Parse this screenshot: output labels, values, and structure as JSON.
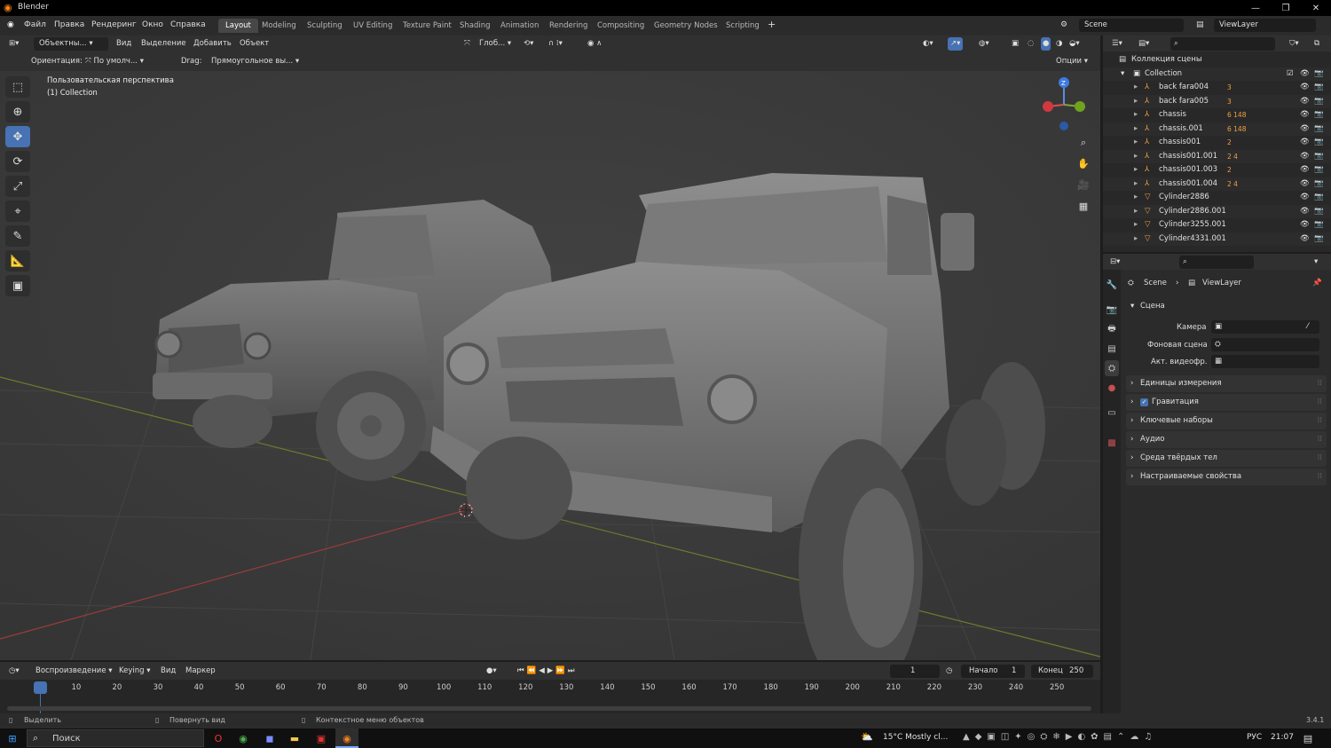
{
  "window": {
    "title": "Blender"
  },
  "menu": [
    "Файл",
    "Правка",
    "Рендеринг",
    "Окно",
    "Справка"
  ],
  "workspaces": [
    "Layout",
    "Modeling",
    "Sculpting",
    "UV Editing",
    "Texture Paint",
    "Shading",
    "Animation",
    "Rendering",
    "Compositing",
    "Geometry Nodes",
    "Scripting"
  ],
  "workspace_active": "Layout",
  "scene_name": "Scene",
  "view_layer_name": "ViewLayer",
  "viewport": {
    "mode": "Объектны...",
    "menus": [
      "Вид",
      "Выделение",
      "Добавить",
      "Объект"
    ],
    "transform": "Глоб...",
    "orientation_label": "Ориентация:",
    "orientation_value": "По умолч...",
    "drag_label": "Drag:",
    "drag_value": "Прямоугольное вы...",
    "options": "Опции",
    "overlay_line1": "Пользовательская перспектива",
    "overlay_line2": "(1) Collection",
    "gizmo_axis_z": "Z"
  },
  "outliner": {
    "root": "Коллекция сцены",
    "collection": "Collection",
    "items": [
      {
        "name": "back fara004",
        "badge": "3"
      },
      {
        "name": "back fara005",
        "badge": "3"
      },
      {
        "name": "chassis",
        "badge": "6 148"
      },
      {
        "name": "chassis.001",
        "badge": "6 148"
      },
      {
        "name": "chassis001",
        "badge": "2"
      },
      {
        "name": "chassis001.001",
        "badge": "2 4"
      },
      {
        "name": "chassis001.003",
        "badge": "2"
      },
      {
        "name": "chassis001.004",
        "badge": "2 4"
      },
      {
        "name": "Cylinder2886",
        "badge": ""
      },
      {
        "name": "Cylinder2886.001",
        "badge": ""
      },
      {
        "name": "Cylinder3255.001",
        "badge": ""
      },
      {
        "name": "Cylinder4331.001",
        "badge": ""
      }
    ]
  },
  "properties": {
    "breadcrumb_scene": "Scene",
    "breadcrumb_layer": "ViewLayer",
    "section": "Сцена",
    "camera_label": "Камера",
    "background_label": "Фоновая сцена",
    "active_clip_label": "Акт. видеофр.",
    "panels": [
      "Единицы измерения",
      "Гравитация",
      "Ключевые наборы",
      "Аудио",
      "Среда твёрдых тел",
      "Настраиваемые свойства"
    ]
  },
  "timeline": {
    "playback": "Воспроизведение",
    "keying": "Keying",
    "view": "Вид",
    "marker": "Маркер",
    "current_frame": "1",
    "start_label": "Начало",
    "start_value": "1",
    "end_label": "Конец",
    "end_value": "250",
    "ticks": [
      "1",
      "10",
      "20",
      "30",
      "40",
      "50",
      "60",
      "70",
      "80",
      "90",
      "100",
      "110",
      "120",
      "130",
      "140",
      "150",
      "160",
      "170",
      "180",
      "190",
      "200",
      "210",
      "220",
      "230",
      "240",
      "250"
    ]
  },
  "status": {
    "select": "Выделить",
    "rotate": "Повернуть вид",
    "context": "Контекстное меню объектов",
    "version": "3.4.1"
  },
  "taskbar": {
    "search": "Поиск",
    "weather": "15°C  Mostly cl...",
    "lang": "РУС",
    "time": "21:07"
  },
  "colors": {
    "accent": "#4772b3",
    "orange": "#f58220",
    "header": "#303030",
    "viewport": "#3a3a3a"
  }
}
